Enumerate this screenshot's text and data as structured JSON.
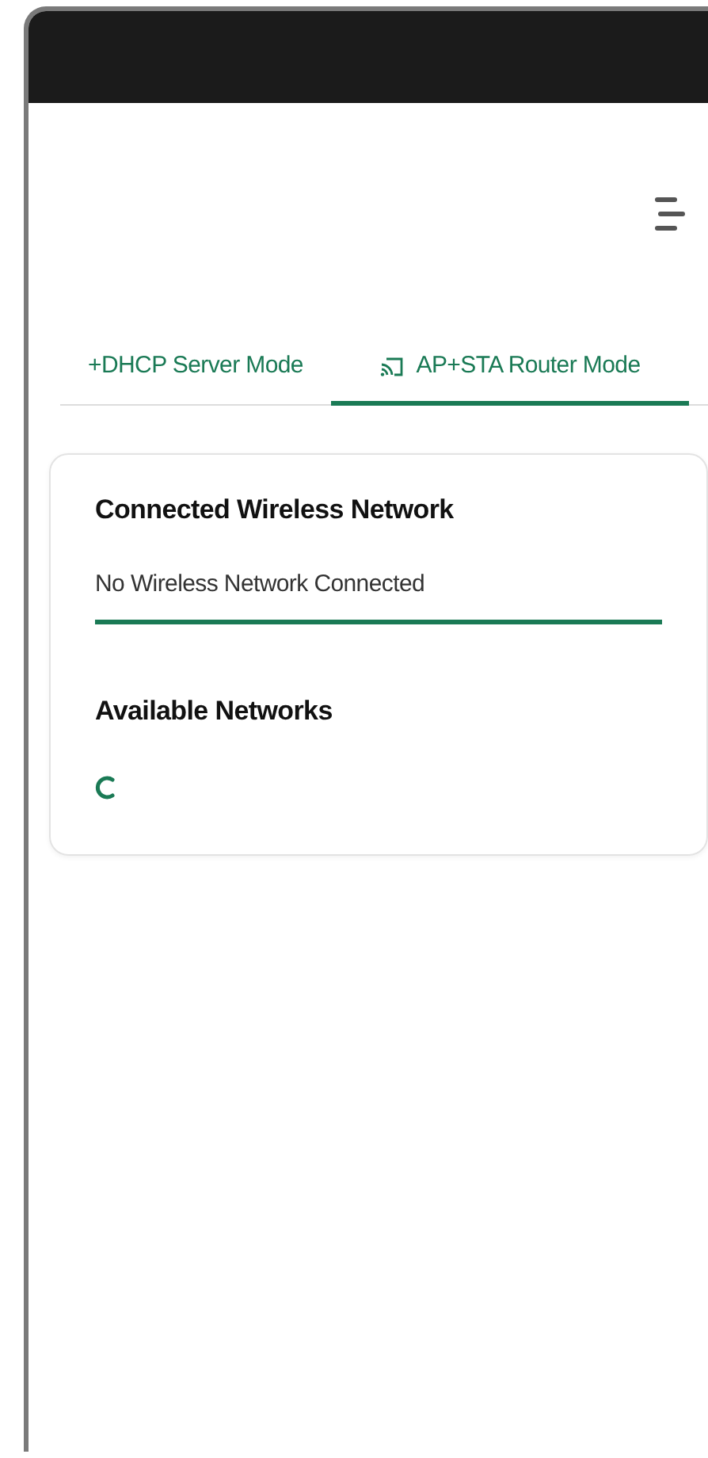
{
  "tabs": [
    {
      "label": "+DHCP Server Mode",
      "icon": false,
      "selected": false
    },
    {
      "label": "AP+STA Router Mode",
      "icon": true,
      "selected": true
    }
  ],
  "card": {
    "connected_title": "Connected Wireless Network",
    "connected_field": {
      "value": "No Wireless Network Connected"
    },
    "available_title": "Available Networks",
    "loading": true
  }
}
